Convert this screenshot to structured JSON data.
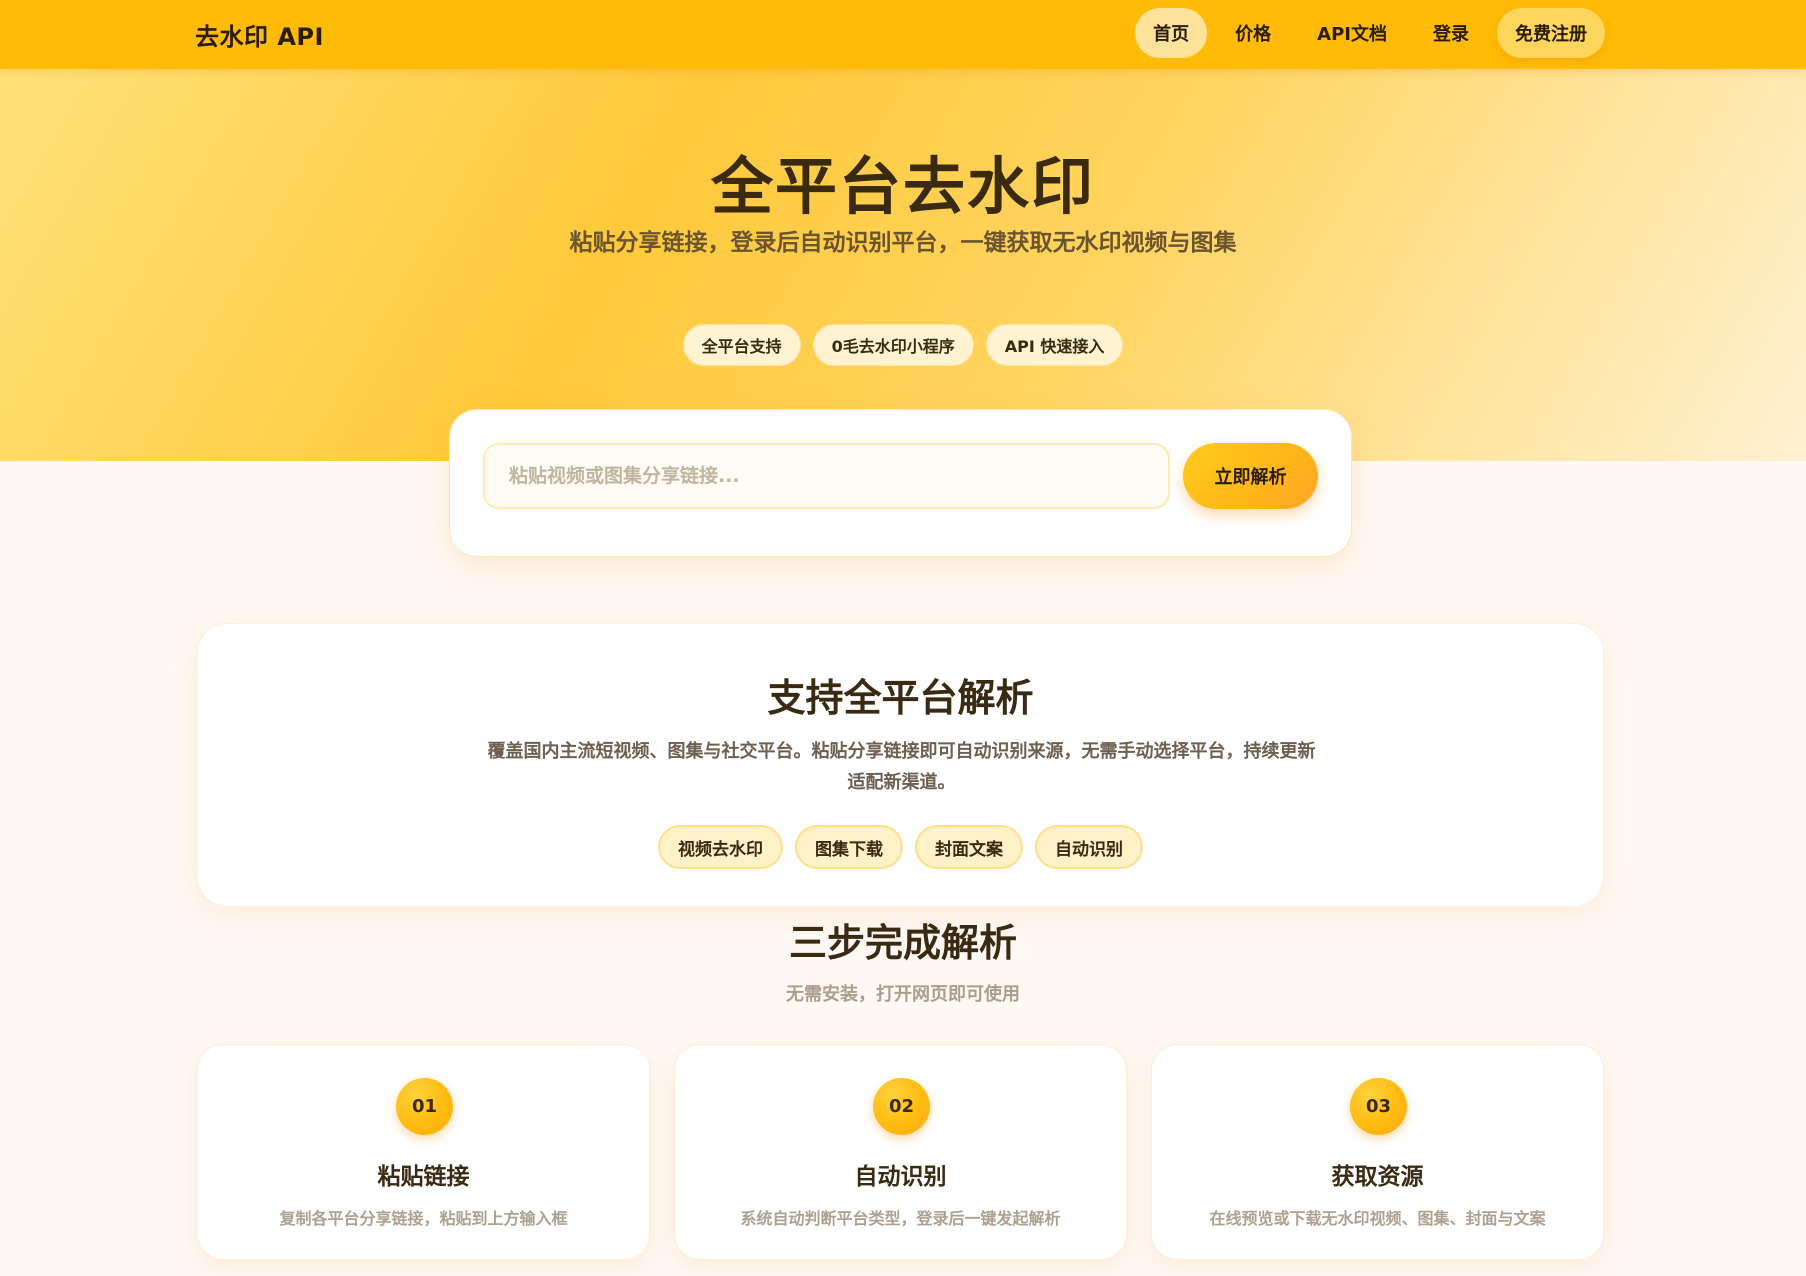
{
  "nav": {
    "brand": "去水印 API",
    "links": [
      {
        "label": "首页"
      },
      {
        "label": "价格"
      },
      {
        "label": "API文档"
      },
      {
        "label": "登录"
      },
      {
        "label": "免费注册"
      }
    ]
  },
  "hero": {
    "title": "全平台去水印",
    "subtitle": "粘贴分享链接，登录后自动识别平台，一键获取无水印视频与图集",
    "tags": [
      "全平台支持",
      "0毛去水印小程序",
      "API 快速接入"
    ]
  },
  "search": {
    "placeholder": "粘贴视频或图集分享链接...",
    "button_label": "立即解析"
  },
  "platforms": {
    "title": "支持全平台解析",
    "description": "覆盖国内主流短视频、图集与社交平台。粘贴分享链接即可自动识别来源，无需手动选择平台，持续更新适配新渠道。",
    "tags": [
      "视频去水印",
      "图集下载",
      "封面文案",
      "自动识别"
    ]
  },
  "steps": {
    "title": "三步完成解析",
    "subtitle": "无需安装，打开网页即可使用",
    "items": [
      {
        "num": "01",
        "title": "粘贴链接",
        "desc": "复制各平台分享链接，粘贴到上方输入框"
      },
      {
        "num": "02",
        "title": "自动识别",
        "desc": "系统自动判断平台类型，登录后一键发起解析"
      },
      {
        "num": "03",
        "title": "获取资源",
        "desc": "在线预览或下载无水印视频、图集、封面与文案"
      }
    ]
  },
  "colors": {
    "navbar": "#ffbb06",
    "accent": "#ffbb10",
    "text_dark": "#3a2a12",
    "page_bg": "#fff8f3"
  }
}
